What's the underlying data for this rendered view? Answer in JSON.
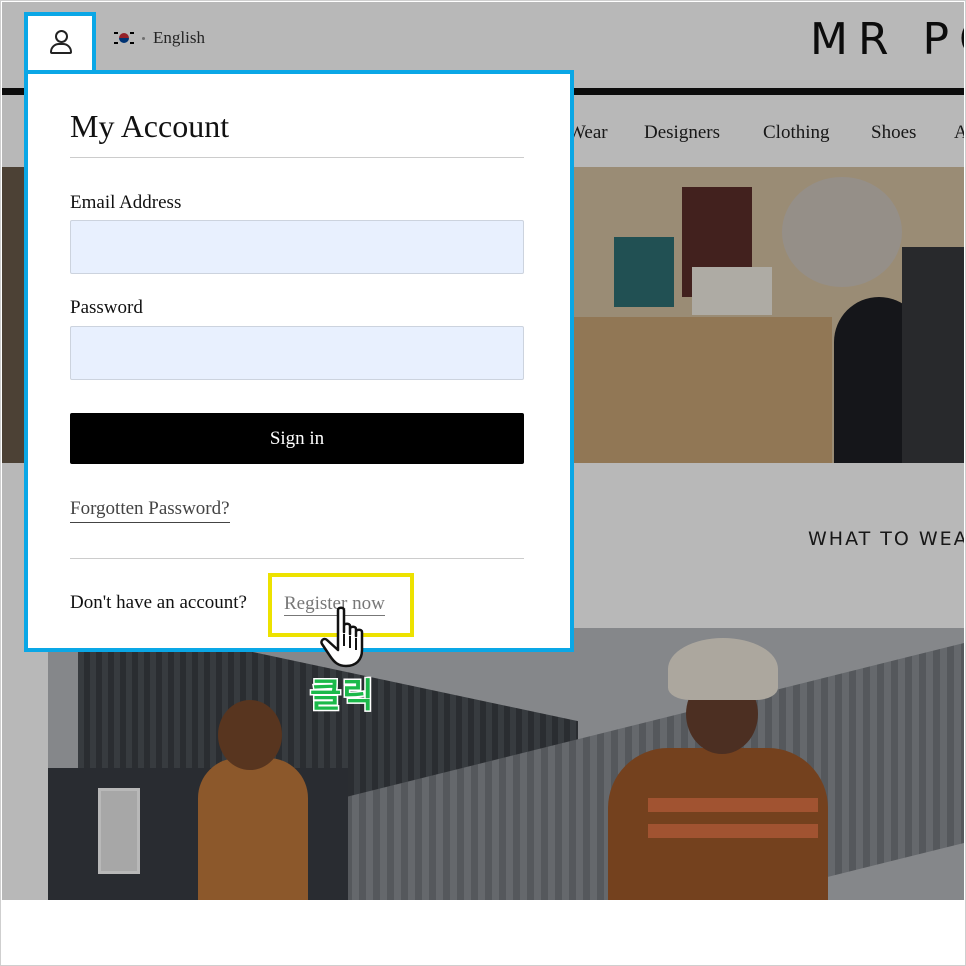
{
  "header": {
    "language": "English",
    "logo": "MR PO"
  },
  "nav": {
    "items": [
      "Wear",
      "Designers",
      "Clothing",
      "Shoes",
      "A"
    ]
  },
  "section": {
    "title": "WHAT TO WEA"
  },
  "account_panel": {
    "title": "My Account",
    "email_label": "Email Address",
    "email_value": "",
    "password_label": "Password",
    "password_value": "",
    "signin_label": "Sign in",
    "forgot_label": "Forgotten Password?",
    "no_account_text": "Don't have an account?",
    "register_label": "Register now"
  },
  "annotation": {
    "click_label": "클릭",
    "highlight_color": "#ede200",
    "panel_border_color": "#0aa7e6",
    "label_color": "#1bb94a"
  },
  "icons": {
    "account": "user-icon",
    "flag": "korea-flag-icon",
    "pointer": "hand-pointer-icon"
  }
}
